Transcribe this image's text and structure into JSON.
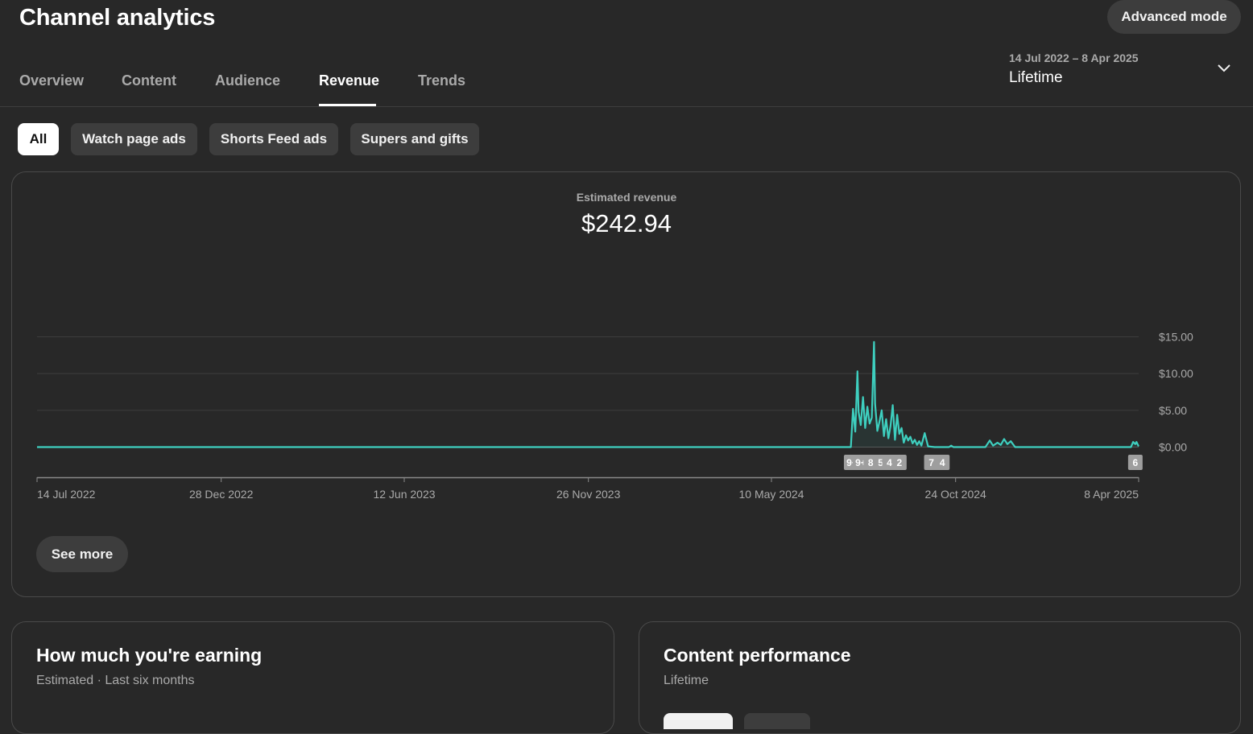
{
  "app": {
    "title": "Channel analytics",
    "advanced_mode_label": "Advanced mode"
  },
  "tabs": [
    {
      "label": "Overview",
      "active": false
    },
    {
      "label": "Content",
      "active": false
    },
    {
      "label": "Audience",
      "active": false
    },
    {
      "label": "Revenue",
      "active": true
    },
    {
      "label": "Trends",
      "active": false
    }
  ],
  "date_selector": {
    "range": "14 Jul 2022 – 8 Apr 2025",
    "period": "Lifetime",
    "icon": "chevron-down-icon"
  },
  "filters": [
    {
      "label": "All",
      "selected": true
    },
    {
      "label": "Watch page ads",
      "selected": false
    },
    {
      "label": "Shorts Feed ads",
      "selected": false
    },
    {
      "label": "Supers and gifts",
      "selected": false
    }
  ],
  "revenue_card": {
    "metric_label": "Estimated revenue",
    "metric_value": "$242.94",
    "see_more_label": "See more"
  },
  "chart_data": {
    "type": "line",
    "title": "",
    "xlabel": "",
    "ylabel": "",
    "x_range": [
      "14 Jul 2022",
      "8 Apr 2025"
    ],
    "ylim": [
      0,
      15
    ],
    "y_ticks": [
      "$15.00",
      "$10.00",
      "$5.00",
      "$0.00"
    ],
    "x_ticks": [
      "14 Jul 2022",
      "28 Dec 2022",
      "12 Jun 2023",
      "26 Nov 2023",
      "10 May 2024",
      "24 Oct 2024",
      "8 Apr 2025"
    ],
    "grid": true,
    "series": [
      {
        "color": "#3ecfbf",
        "points": [
          [
            "14 Jul 2022",
            0
          ],
          [
            "28 Dec 2022",
            0
          ],
          [
            "12 Jun 2023",
            0
          ],
          [
            "26 Nov 2023",
            0
          ],
          [
            "10 May 2024",
            0
          ],
          [
            "21 Jul 2024",
            0
          ],
          [
            "23 Jul 2024",
            5.2
          ],
          [
            "25 Jul 2024",
            2.1
          ],
          [
            "27 Jul 2024",
            10.3
          ],
          [
            "28 Jul 2024",
            4.8
          ],
          [
            "30 Jul 2024",
            3.0
          ],
          [
            "1 Aug 2024",
            6.8
          ],
          [
            "3 Aug 2024",
            2.6
          ],
          [
            "5 Aug 2024",
            5.5
          ],
          [
            "7 Aug 2024",
            3.2
          ],
          [
            "9 Aug 2024",
            4.0
          ],
          [
            "11 Aug 2024",
            14.3
          ],
          [
            "12 Aug 2024",
            5.9
          ],
          [
            "14 Aug 2024",
            2.2
          ],
          [
            "16 Aug 2024",
            3.5
          ],
          [
            "18 Aug 2024",
            5.0
          ],
          [
            "20 Aug 2024",
            1.5
          ],
          [
            "22 Aug 2024",
            3.8
          ],
          [
            "24 Aug 2024",
            1.2
          ],
          [
            "26 Aug 2024",
            2.9
          ],
          [
            "28 Aug 2024",
            5.7
          ],
          [
            "30 Aug 2024",
            1.0
          ],
          [
            "1 Sep 2024",
            4.4
          ],
          [
            "3 Sep 2024",
            1.8
          ],
          [
            "5 Sep 2024",
            2.6
          ],
          [
            "7 Sep 2024",
            0.6
          ],
          [
            "9 Sep 2024",
            1.6
          ],
          [
            "11 Sep 2024",
            0.9
          ],
          [
            "13 Sep 2024",
            1.4
          ],
          [
            "15 Sep 2024",
            0.5
          ],
          [
            "17 Sep 2024",
            1.0
          ],
          [
            "19 Sep 2024",
            0.3
          ],
          [
            "21 Sep 2024",
            0.8
          ],
          [
            "23 Sep 2024",
            0.2
          ],
          [
            "26 Sep 2024",
            1.9
          ],
          [
            "29 Sep 2024",
            0.1
          ],
          [
            "5 Oct 2024",
            0
          ],
          [
            "18 Oct 2024",
            0
          ],
          [
            "20 Oct 2024",
            0.2
          ],
          [
            "22 Oct 2024",
            0
          ],
          [
            "20 Nov 2024",
            0
          ],
          [
            "24 Nov 2024",
            0.9
          ],
          [
            "27 Nov 2024",
            0.2
          ],
          [
            "1 Dec 2024",
            0.6
          ],
          [
            "4 Dec 2024",
            0.3
          ],
          [
            "7 Dec 2024",
            1.1
          ],
          [
            "10 Dec 2024",
            0.4
          ],
          [
            "13 Dec 2024",
            0.8
          ],
          [
            "17 Dec 2024",
            0
          ],
          [
            "1 Apr 2025",
            0
          ],
          [
            "3 Apr 2025",
            0.7
          ],
          [
            "5 Apr 2025",
            0.4
          ],
          [
            "6 Apr 2025",
            0.7
          ],
          [
            "8 Apr 2025",
            0.1
          ]
        ]
      }
    ],
    "annotations": [
      {
        "date": "22 Jul 2024",
        "label": "9+"
      },
      {
        "date": "30 Jul 2024",
        "label": "9+"
      },
      {
        "date": "8 Aug 2024",
        "label": "8"
      },
      {
        "date": "17 Aug 2024",
        "label": "5"
      },
      {
        "date": "25 Aug 2024",
        "label": "4"
      },
      {
        "date": "3 Sep 2024",
        "label": "2"
      },
      {
        "date": "2 Oct 2024",
        "label": "7"
      },
      {
        "date": "12 Oct 2024",
        "label": "4"
      },
      {
        "date": "5 Apr 2025",
        "label": "6"
      }
    ]
  },
  "earning_card": {
    "title": "How much you're earning",
    "subtitle": "Estimated · Last six months"
  },
  "content_card": {
    "title": "Content performance",
    "subtitle": "Lifetime"
  }
}
